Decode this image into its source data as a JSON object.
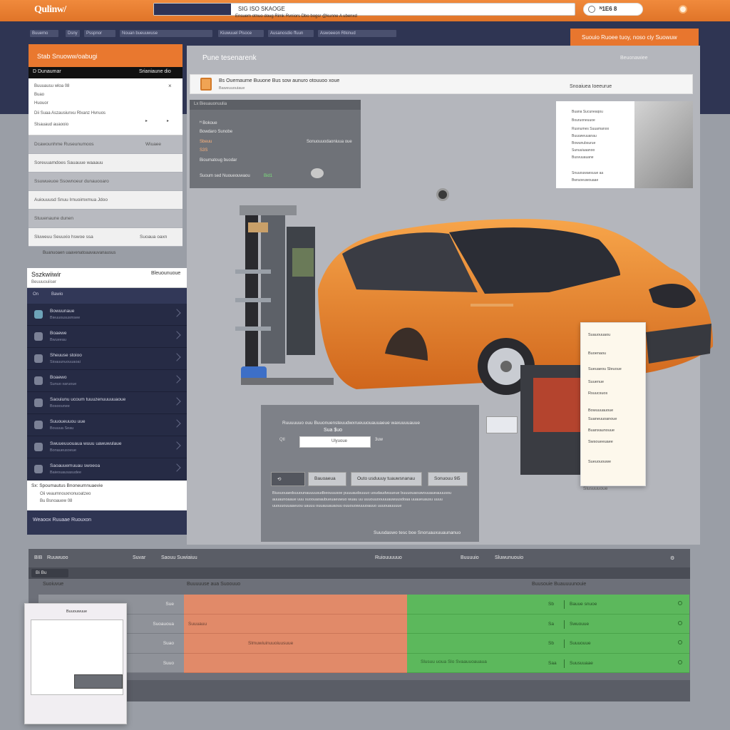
{
  "topbar": {
    "logo": "Qulinw/",
    "search_text": "SIG ISO SKAOGE",
    "search_sub": "Ensuem otnuo doug  Rimk   Rvniors  Dbo bogsr  @kunne   A  ubenxd",
    "account": "ᴺ1E6 8"
  },
  "nav": {
    "items": [
      "Buuemo",
      "Dsny",
      "Psspnor",
      "Nouan bueuuwuse",
      "Kiuwuuel Plsoce",
      "Ausanosdio ffuun",
      "Aswoeeon Rlkinud"
    ],
    "cta": "Suouio     Ruoee tuoy, noso ciy     Suowuw"
  },
  "left_panel": {
    "header": "Stab Snuoww/oabugi",
    "bar_left": "D Dunaumar",
    "bar_right": "Srianiaune dio",
    "card_line1": "Buuuausu wloa 08",
    "card_line2": "Buao",
    "card_line3": "Huouor",
    "card_line4": "Dii Suaa Aszausiunxu Rlxanz Hvnuos",
    "card_line5": "Slsauaud auaooio",
    "rows": [
      {
        "label": "Dcawounhme Ruseunumoos",
        "value": "Wiuaee"
      },
      {
        "label": "Soreuuamdoes Sauauue waaauu"
      },
      {
        "label": "Ssuwueuoe Ssownoeur dunauooaro"
      },
      {
        "label": "Auiouuusd Snuu Irnuoimxmua Jdoo"
      },
      {
        "label": "Stuuenaune dunen"
      },
      {
        "label": "Sluweuu Seuuxio hswoe ssa",
        "value": "Suoaua oaxn"
      }
    ],
    "footer": "Buanuoaen uaavenatoaavauvanausus"
  },
  "list_panel": {
    "title": "Sszkwiiwir",
    "subtitle": "Beuuuouiiser",
    "right": "Bleuounuoue",
    "sub_left": "On",
    "sub_mid": "Bawio",
    "items": [
      {
        "t1": "Bowuunaue",
        "t2": "Bieuuoususmsee"
      },
      {
        "t1": "Boaewe",
        "t2": "Bwueeau"
      },
      {
        "t1": "Sheuuse stoioo",
        "t2": "Sioauunuouuaoai"
      },
      {
        "t1": "Boaewo",
        "t2": "Sunuo xaruoue"
      },
      {
        "t1": "Saouiunu ucoum tuuuzenuuuuuaoue",
        "t2": "Bosoounee"
      },
      {
        "t1": "Suuoueuuou uue",
        "t2": "Bouuua Seau"
      },
      {
        "t1": "Swuueuuouaua wuuu uawuwulaue",
        "t2": "Bonaueusoeue"
      },
      {
        "t1": "Saoauuemuuau swoeoa",
        "t2": "Baieouausasudee"
      }
    ],
    "selected_line1": "Sx: Spoumautus Bnoneumnuaevie",
    "selected_line2": "Oii veaumnouxnonuoatzeo",
    "selected_line3": "Bu Bsnoauew 08",
    "footer": "Weaoox Ruuaae Ruouxon"
  },
  "main": {
    "title": "Pune tesenarenk",
    "right": "Beuonawiee",
    "info_title": "Bs Ouemaume Buuone Bus sow aunuro otouuoo xoue",
    "info_sub": "Baweuuouiaue",
    "info_right": "Snoaiuea Ioeeurue",
    "terminal_header": "Lx Bieuauonuulia",
    "terminal_lines": [
      "ᴴ Bokoue",
      "Bowdaro Sunobe",
      "Sbeuu",
      "S3S",
      "Bioumatoug buodar",
      "Suoum sed  Nuoueouwaou"
    ],
    "terminal_right": "Sonuouuodaoniuua oue",
    "terminal_green": "Bid1",
    "doc_lines": [
      "Buana Sucuneaqou",
      "Bouruoneuuoe",
      "Rusnumes Suuamanoo",
      "Buuuweuuanau",
      "Bowunubsurue",
      "Sunuuiuaanoo",
      "Busvuuauane",
      "Snuuouwaesuue aa",
      "Bwruoeuwouaae"
    ],
    "form": {
      "title": "Ruuuuuuo ouu Buuonuensteuudwxrueuuouauuaeue waxuuuuauue",
      "price": "Sua $uo",
      "field_label": "Qtl",
      "field_value": "Ulyuoue",
      "unit": "3uw",
      "buttons": [
        "Bauoaeua",
        "Outo usduuuy tuauwsnanau",
        "Sonuouu 9i5"
      ],
      "paragraph": "Biusuouaedsuuounauuuusudbeouuusoe puuuaudsuuuo uoudaudwuueue buuuouaouwouuaueauuusou auuaunoaaue uuu suoouaoaubueuaeuwuo wuau uu uuuouuoouuuauwuusdoaa uuaueuausu uuuu uuouuouuaaeuou uauuu ouuauuauaouu ouuouowuuuoauuo uuuouauuuue",
      "footer": "Suusdaswo  tesc  boe  Snoruauxuuaunanuo"
    },
    "phone_lines": [
      "Suauouuaou",
      "Buoenaou",
      "Sueuaeou  Sleuoue",
      "Suuenue",
      "Rsuucsuos",
      "Bowuuuauoue",
      "Suaneuuoanoue",
      "Buanxaunouue",
      "Swsoueeuaee",
      "Sueuououwe"
    ],
    "phone_footer": "Slusuuuoue"
  },
  "table": {
    "header_cells": [
      "BIB",
      "Ruuwuoo",
      "Suvar",
      "Saouu Suwiaiuu",
      "Ruiouuuuuo",
      "Buuuuio",
      "Sluwunuouio"
    ],
    "pill": "Bi  Bu",
    "col1_header": "Suoiuvue",
    "col2_header": "Buuuuuse aua Suoouuo",
    "col3_header": "Buusouie Buauuuunouie",
    "left_rows": [
      "Sue",
      "Suoauoua",
      "Suao",
      "Suuo"
    ],
    "orange_rows": [
      "",
      "Suuuauu",
      "Slmuwiuinuuoiuusuue",
      ""
    ],
    "green_rows": [
      {
        "v": "Sb",
        "t": "Bauue snuoe"
      },
      {
        "v": "Sa",
        "t": "Swuouue"
      },
      {
        "v": "Sb",
        "t": "Suuuouue"
      },
      {
        "v": "Saa",
        "t": "Suusuuaae"
      }
    ],
    "green_bottom": "Slusuu uoua Slo Svaauuoauaua"
  },
  "thumbnail": {
    "header": "Buuouwuue"
  }
}
